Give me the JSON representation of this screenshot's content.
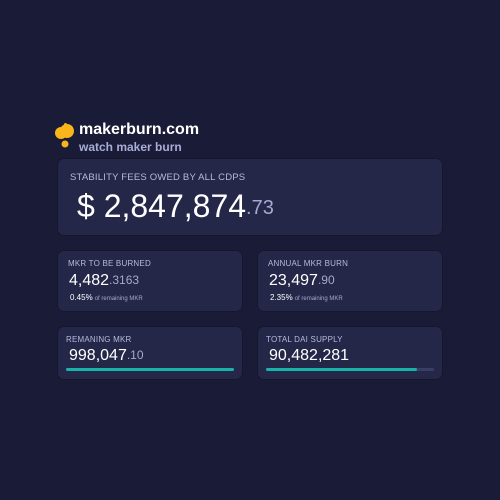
{
  "brand": {
    "name": "makerburn.com",
    "tagline": "watch maker burn",
    "logo_color": "#f9b51b"
  },
  "fees": {
    "label": "STABILITY FEES OWED BY ALL CDPS",
    "currency": "$",
    "value_int": "2,847,874",
    "value_dec": ".73"
  },
  "mkr_to_be_burned": {
    "label": "MKR TO BE BURNED",
    "value_int": "4,482",
    "value_dec": ".3163",
    "pct": "0.45%",
    "pct_sub": "of remaining MKR"
  },
  "annual_mkr_burn": {
    "label": "ANNUAL MKR BURN",
    "value_int": "23,497",
    "value_dec": ".90",
    "pct": "2.35%",
    "pct_sub": "of remaining MKR"
  },
  "remaining_mkr": {
    "label": "REMANING MKR",
    "value_int": "998,047",
    "value_dec": ".10",
    "progress": 1.0,
    "bar_color": "#17b3a9"
  },
  "total_dai_supply": {
    "label": "TOTAL DAI SUPPLY",
    "value_int": "90,482,281",
    "value_dec": "",
    "progress": 0.9,
    "bar_color": "#17b3a9"
  }
}
